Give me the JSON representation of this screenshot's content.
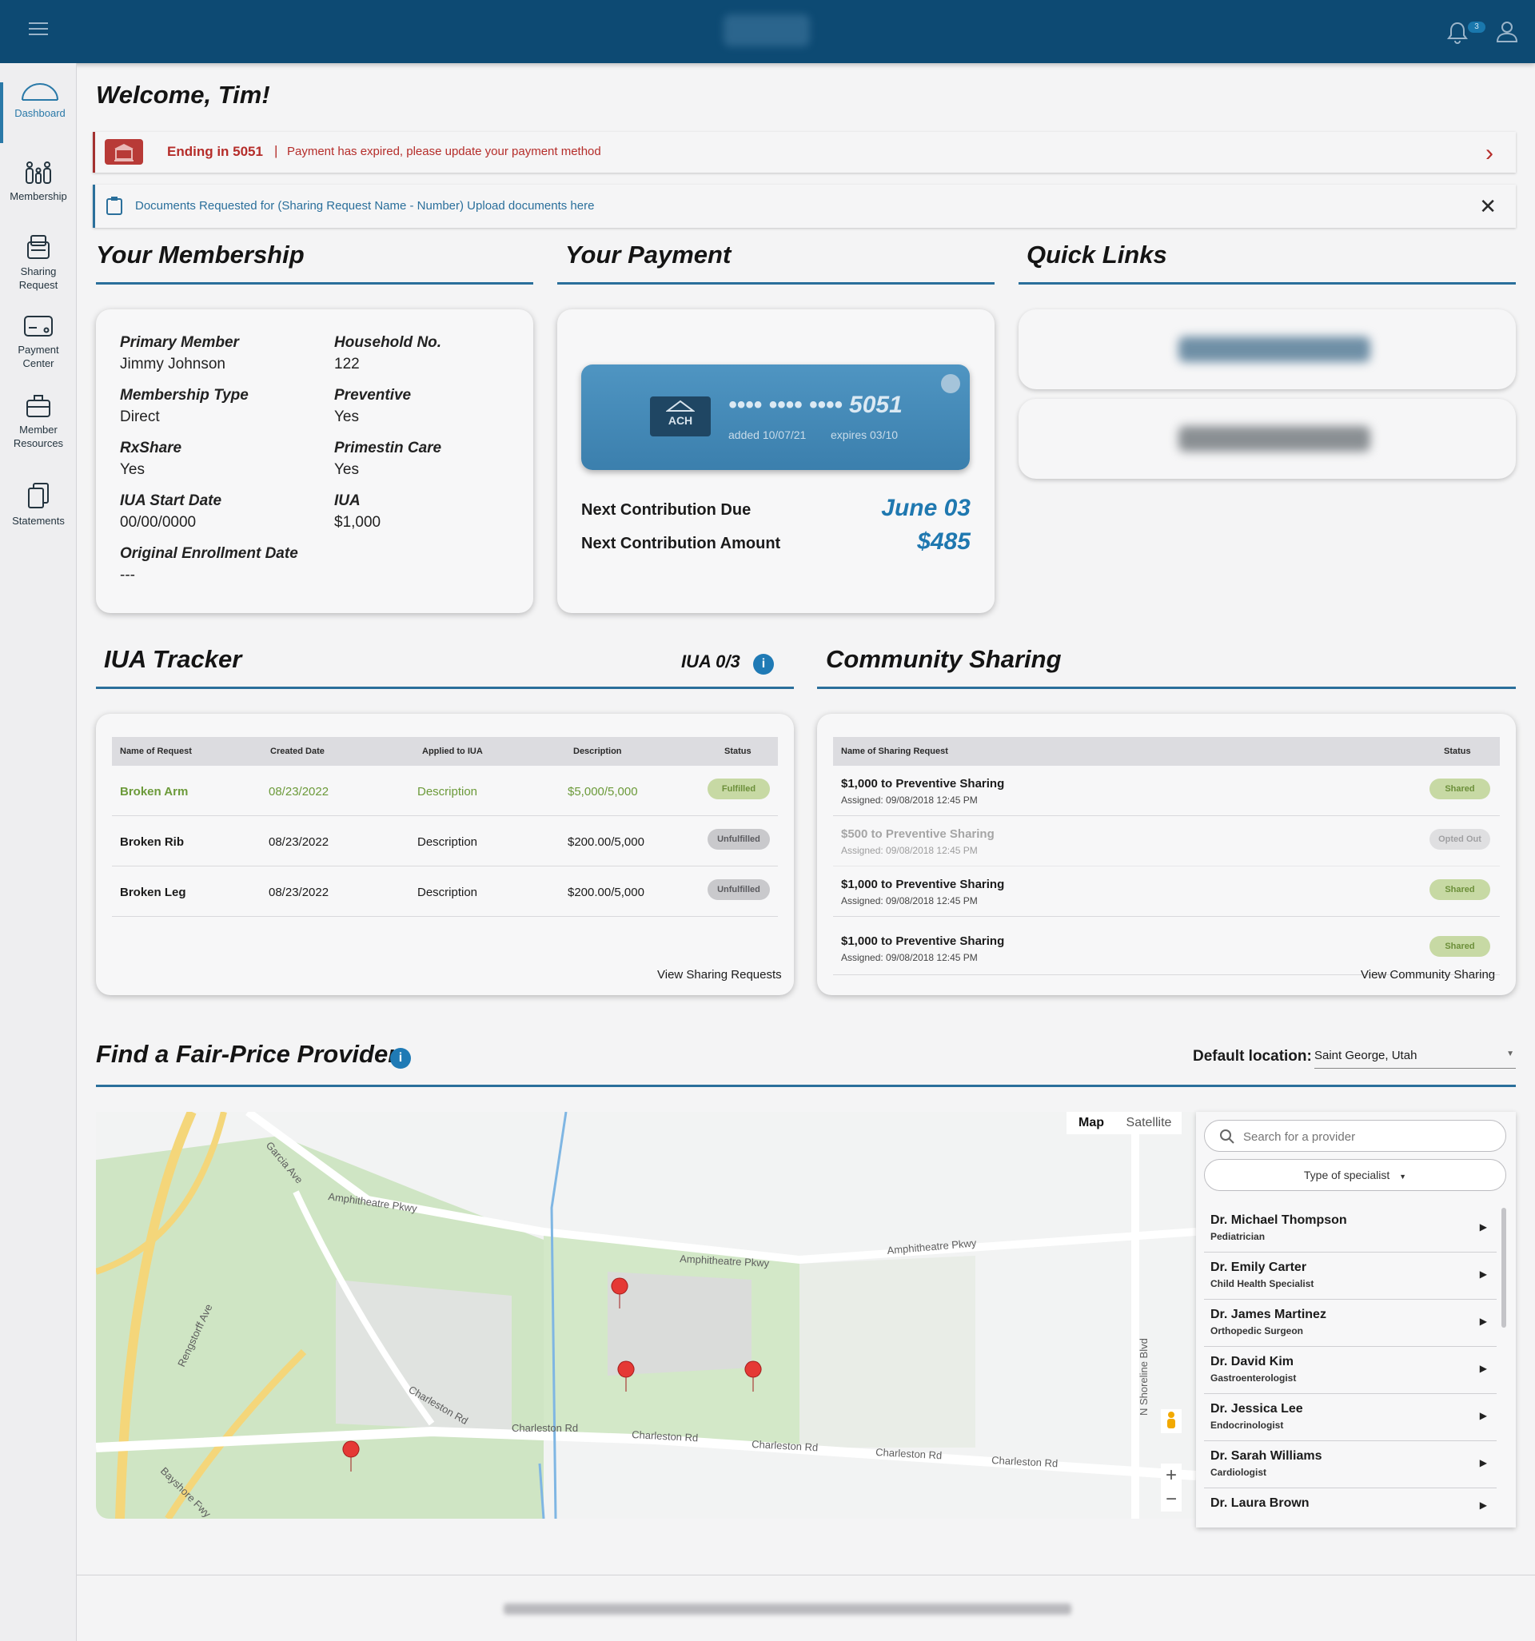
{
  "header": {
    "notification_count": "3"
  },
  "sidebar": {
    "items": [
      {
        "label": "Dashboard"
      },
      {
        "label": "Membership"
      },
      {
        "label": "Sharing Request"
      },
      {
        "label": "Payment Center"
      },
      {
        "label": "Member Resources"
      },
      {
        "label": "Statements"
      }
    ]
  },
  "welcome": "Welcome, Tim!",
  "alerts": {
    "payment": {
      "title": "Ending in 5051",
      "separator": "|",
      "message": "Payment has expired, please update your payment method"
    },
    "documents": {
      "message": "Documents Requested for (Sharing Request Name - Number) Upload documents here"
    }
  },
  "membership": {
    "title": "Your Membership",
    "fields": [
      {
        "label": "Primary Member",
        "value": "Jimmy Johnson"
      },
      {
        "label": "Household No.",
        "value": "122"
      },
      {
        "label": "Membership Type",
        "value": "Direct"
      },
      {
        "label": "Preventive",
        "value": "Yes"
      },
      {
        "label": "RxShare",
        "value": "Yes"
      },
      {
        "label": "Primestin Care",
        "value": "Yes"
      },
      {
        "label": "IUA Start Date",
        "value": "00/00/0000"
      },
      {
        "label": "IUA",
        "value": "$1,000"
      },
      {
        "label": "Original Enrollment Date",
        "value": "---"
      }
    ]
  },
  "payment": {
    "title": "Your Payment",
    "card_type": "ACH",
    "card_number": "•••• •••• •••• 5051",
    "added": "added 10/07/21",
    "expires": "expires 03/10",
    "next_due_label": "Next Contribution Due",
    "next_due_value": "June 03",
    "next_amount_label": "Next Contribution Amount",
    "next_amount_value": "$485"
  },
  "quick_links": {
    "title": "Quick Links"
  },
  "iua_tracker": {
    "title": "IUA Tracker",
    "count_label": "IUA 0/3",
    "columns": [
      "Name of Request",
      "Created Date",
      "Applied to IUA",
      "Description",
      "Status"
    ],
    "rows": [
      {
        "name": "Broken Arm",
        "date": "08/23/2022",
        "applied": "Description",
        "description": "$5,000/5,000",
        "status": "Fulfilled"
      },
      {
        "name": "Broken Rib",
        "date": "08/23/2022",
        "applied": "Description",
        "description": "$200.00/5,000",
        "status": "Unfulfilled"
      },
      {
        "name": "Broken Leg",
        "date": "08/23/2022",
        "applied": "Description",
        "description": "$200.00/5,000",
        "status": "Unfulfilled"
      }
    ],
    "link": "View Sharing Requests"
  },
  "community_sharing": {
    "title": "Community Sharing",
    "columns": [
      "Name of Sharing Request",
      "Status"
    ],
    "rows": [
      {
        "name": "$1,000 to Preventive Sharing",
        "assigned": "Assigned: 09/08/2018  12:45 PM",
        "status": "Shared"
      },
      {
        "name": "$500 to Preventive Sharing",
        "assigned": "Assigned: 09/08/2018  12:45 PM",
        "status": "Opted Out"
      },
      {
        "name": "$1,000 to Preventive Sharing",
        "assigned": "Assigned: 09/08/2018  12:45 PM",
        "status": "Shared"
      },
      {
        "name": "$1,000 to Preventive Sharing",
        "assigned": "Assigned: 09/08/2018  12:45 PM",
        "status": "Shared"
      }
    ],
    "link": "View Community Sharing"
  },
  "provider": {
    "title": "Find a Fair-Price Provider",
    "location_label": "Default location:",
    "location_value": "Saint George, Utah",
    "map_tabs": [
      "Map",
      "Satellite"
    ],
    "street_labels": [
      "Amphitheatre Pkwy",
      "Amphitheatre Pkwy",
      "Amphitheatre Pkwy",
      "Charleston Rd",
      "Charleston Rd",
      "Charleston Rd",
      "Charleston Rd",
      "Charleston Rd",
      "Charleston Rd",
      "Rengstorff Ave",
      "Bayshore Fwy",
      "N Shoreline Blvd",
      "Garcia Ave"
    ],
    "search_placeholder": "Search for a provider",
    "specialist_label": "Type of specialist",
    "doctors": [
      {
        "name": "Dr. Michael Thompson",
        "specialty": "Pediatrician"
      },
      {
        "name": "Dr. Emily Carter",
        "specialty": "Child Health Specialist"
      },
      {
        "name": "Dr. James Martinez",
        "specialty": "Orthopedic Surgeon"
      },
      {
        "name": "Dr. David Kim",
        "specialty": "Gastroenterologist"
      },
      {
        "name": "Dr. Jessica Lee",
        "specialty": "Endocrinologist"
      },
      {
        "name": "Dr. Sarah Williams",
        "specialty": "Cardiologist"
      },
      {
        "name": "Dr. Laura Brown",
        "specialty": ""
      }
    ]
  },
  "colors": {
    "brand": "#0d4a73",
    "accent": "#1f78b0",
    "alert": "#b52d2a",
    "fulfilled": "#6c8f3a"
  }
}
